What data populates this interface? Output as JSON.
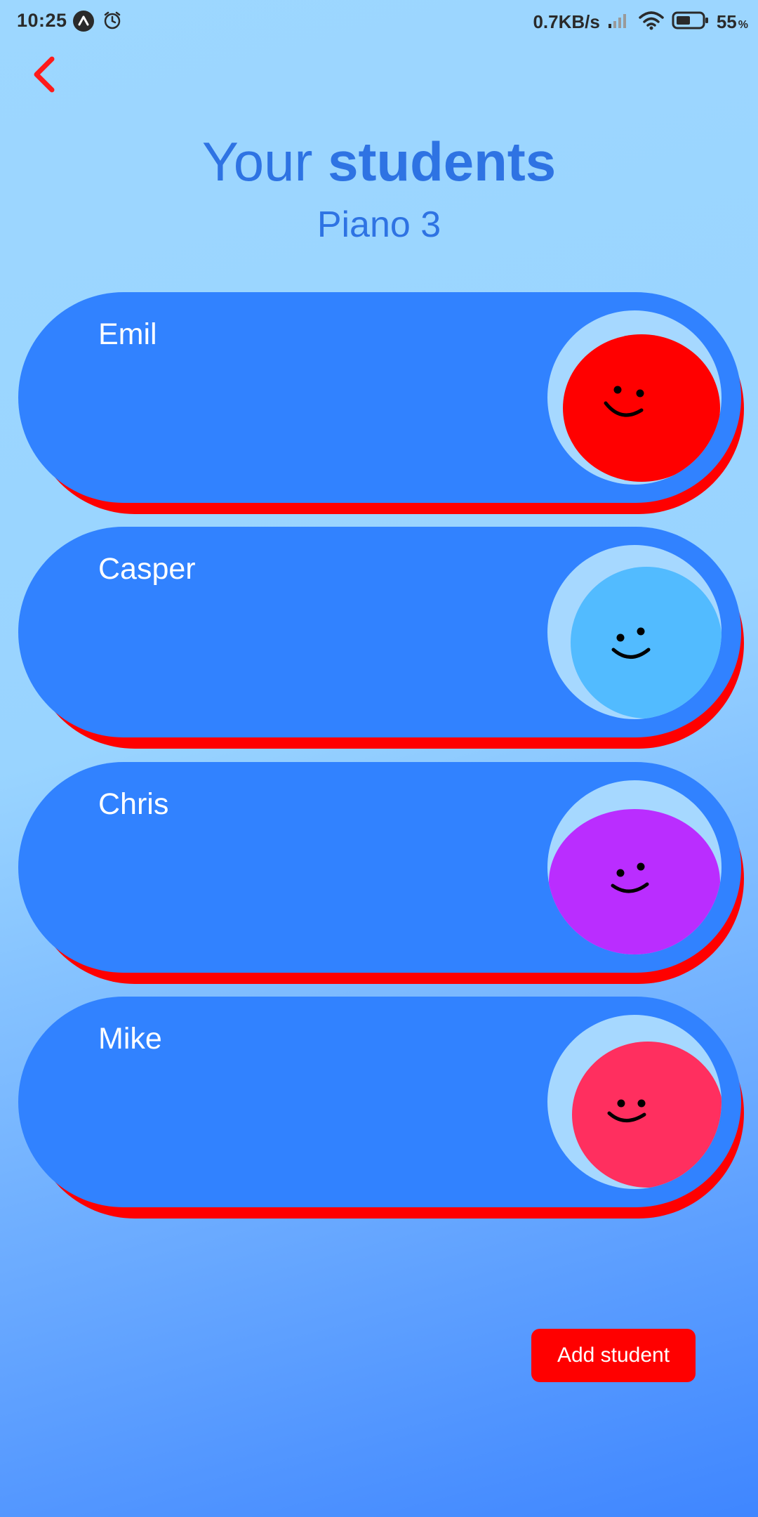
{
  "status_bar": {
    "time": "10:25",
    "network_speed": "0.7KB/s",
    "battery_percent": "55",
    "battery_unit": "%",
    "battery_level": 0.55,
    "icons": [
      "app-notification-icon",
      "alarm-icon",
      "signal-icon",
      "wifi-icon",
      "battery-icon"
    ]
  },
  "navigation": {
    "back_icon": "chevron-left-icon",
    "back_color": "#ff1a1a"
  },
  "header": {
    "title_regular": "Your ",
    "title_bold": "students",
    "subtitle": "Piano 3",
    "color": "#2e73e3"
  },
  "students": [
    {
      "name": "Emil",
      "avatar_color": "#ff0000"
    },
    {
      "name": "Casper",
      "avatar_color": "#52bbff"
    },
    {
      "name": "Chris",
      "avatar_color": "#ba2dff"
    },
    {
      "name": "Mike",
      "avatar_color": "#ff2f5f"
    }
  ],
  "card_colors": {
    "body": "#3182ff",
    "shadow": "#ff0000"
  },
  "actions": {
    "add_student_label": "Add student",
    "add_student_color": "#ff0000"
  }
}
